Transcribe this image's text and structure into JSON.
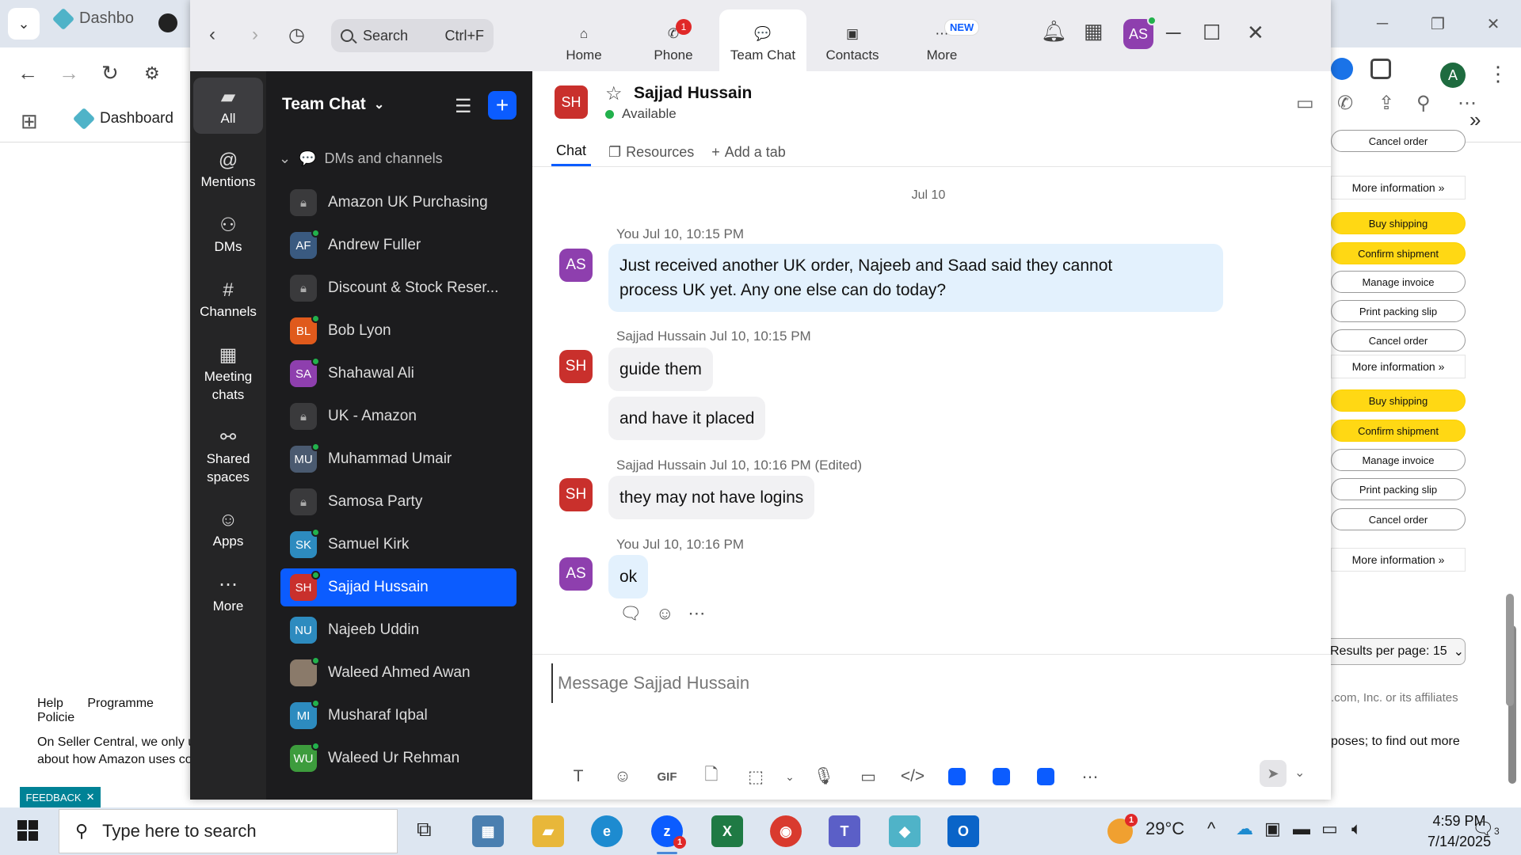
{
  "browser": {
    "tab_title": "Dashbo",
    "bookmark": "Dashboard",
    "profile_initial": "A"
  },
  "seller": {
    "buttons": [
      {
        "label": "Cancel order",
        "style": "plain"
      },
      {
        "label": "More information »",
        "style": "more"
      },
      {
        "label": "Buy shipping",
        "style": "yellow"
      },
      {
        "label": "Confirm shipment",
        "style": "yellow"
      },
      {
        "label": "Manage invoice",
        "style": "plain"
      },
      {
        "label": "Print packing slip",
        "style": "plain"
      },
      {
        "label": "Cancel order",
        "style": "plain"
      },
      {
        "label": "More information »",
        "style": "more"
      },
      {
        "label": "Buy shipping",
        "style": "yellow"
      },
      {
        "label": "Confirm shipment",
        "style": "yellow"
      },
      {
        "label": "Manage invoice",
        "style": "plain"
      },
      {
        "label": "Print packing slip",
        "style": "plain"
      },
      {
        "label": "Cancel order",
        "style": "plain"
      },
      {
        "label": "More information »",
        "style": "more"
      }
    ],
    "results_per_page": "Results per page: 15",
    "copyright": ".com, Inc. or its affiliates",
    "footer_right": "poses; to find out more",
    "footer_links": [
      "Help",
      "Programme Policie"
    ],
    "footer_para": "On Seller Central, we only u about how Amazon uses co",
    "feedback": "FEEDBACK"
  },
  "zoom": {
    "search_placeholder": "Search",
    "search_shortcut": "Ctrl+F",
    "tabs": [
      {
        "label": "Home",
        "icon": "home-icon"
      },
      {
        "label": "Phone",
        "icon": "phone-icon",
        "badge": "1"
      },
      {
        "label": "Team Chat",
        "icon": "chat-icon",
        "active": true
      },
      {
        "label": "Contacts",
        "icon": "contacts-icon"
      },
      {
        "label": "More",
        "icon": "more-icon",
        "new": "NEW"
      }
    ],
    "user_initials": "AS",
    "rail": [
      {
        "label": "All",
        "icon": "chat-bubble-icon"
      },
      {
        "label": "Mentions",
        "icon": "at-icon"
      },
      {
        "label": "DMs",
        "icon": "people-icon"
      },
      {
        "label": "Channels",
        "icon": "hash-icon"
      },
      {
        "label": "Meeting chats",
        "icon": "calendar-icon"
      },
      {
        "label": "Shared spaces",
        "icon": "shared-icon"
      },
      {
        "label": "Apps",
        "icon": "apps-icon"
      },
      {
        "label": "More",
        "icon": "ellipsis-icon"
      }
    ],
    "list_title": "Team Chat",
    "section_title": "DMs and channels",
    "conversations": [
      {
        "name": "Amazon UK Purchasing",
        "initials": "",
        "color": "#3a3a3c",
        "lock": true
      },
      {
        "name": "Andrew Fuller",
        "initials": "AF",
        "color": "#3a5a80",
        "online": true
      },
      {
        "name": "Discount & Stock Reser...",
        "initials": "",
        "color": "#3a3a3c",
        "lock": true
      },
      {
        "name": "Bob Lyon",
        "initials": "BL",
        "color": "#e05a1c",
        "online": true
      },
      {
        "name": "Shahawal Ali",
        "initials": "SA",
        "color": "#8e3fae",
        "online": true
      },
      {
        "name": "UK - Amazon",
        "initials": "",
        "color": "#3a3a3c",
        "lock": true
      },
      {
        "name": "Muhammad Umair",
        "initials": "MU",
        "color": "#4a5a70",
        "online": true
      },
      {
        "name": "Samosa Party",
        "initials": "",
        "color": "#3a3a3c",
        "lock": true
      },
      {
        "name": "Samuel Kirk",
        "initials": "SK",
        "color": "#2d8bbf",
        "online": true
      },
      {
        "name": "Sajjad Hussain",
        "initials": "SH",
        "color": "#c9302c",
        "online": true,
        "active": true
      },
      {
        "name": "Najeeb Uddin",
        "initials": "NU",
        "color": "#2d8bbf"
      },
      {
        "name": "Waleed Ahmed Awan",
        "initials": "",
        "color": "#8a7a6a",
        "online": true
      },
      {
        "name": "Musharaf Iqbal",
        "initials": "MI",
        "color": "#2d8bbf",
        "online": true
      },
      {
        "name": "Waleed Ur Rehman",
        "initials": "WU",
        "color": "#3d9c3d",
        "online": true
      }
    ],
    "chat": {
      "name": "Sajjad Hussain",
      "initials": "SH",
      "status": "Available",
      "tabs": [
        "Chat",
        "Resources",
        "Add a tab"
      ],
      "date": "Jul 10",
      "messages": [
        {
          "sender": "You",
          "time": "Jul 10, 10:15 PM",
          "initials": "AS",
          "color": "#8e3fae",
          "bubbles": [
            "Just received another UK order, Najeeb and Saad said they cannot",
            "process UK yet. Any one else can do today?"
          ],
          "mine": true
        },
        {
          "sender": "Sajjad Hussain",
          "time": "Jul 10, 10:15 PM",
          "initials": "SH",
          "color": "#c9302c",
          "bubbles": [
            "guide them",
            "and have it placed"
          ]
        },
        {
          "sender": "Sajjad Hussain",
          "time": "Jul 10, 10:16 PM",
          "edited": "(Edited)",
          "initials": "SH",
          "color": "#c9302c",
          "bubbles": [
            "they may not have logins"
          ]
        },
        {
          "sender": "You",
          "time": "Jul 10, 10:16 PM",
          "initials": "AS",
          "color": "#8e3fae",
          "bubbles": [
            "ok"
          ],
          "mine": true
        }
      ],
      "compose_placeholder": "Message Sajjad Hussain",
      "gif_label": "GIF"
    }
  },
  "taskbar": {
    "search_placeholder": "Type here to search",
    "temperature": "29°C",
    "time": "4:59 PM",
    "date": "7/14/2025",
    "notifications": "3",
    "zoom_badge": "1",
    "weather_badge": "1"
  }
}
